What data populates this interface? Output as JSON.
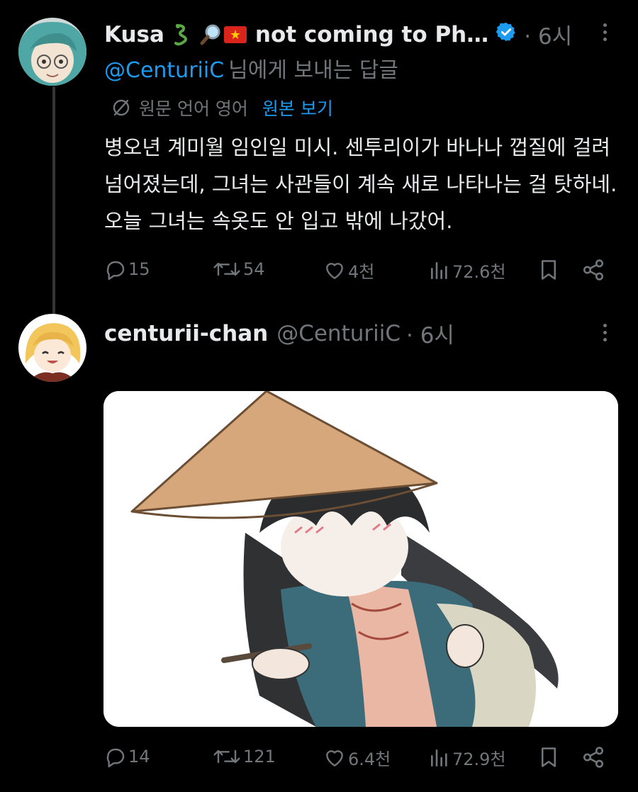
{
  "tweet1": {
    "display_name": "Kusa",
    "name_suffix": "not coming to Ph…",
    "time": "· 6시",
    "reply_handle": "@CenturiiC",
    "reply_suffix": "님에게 보내는 답글",
    "translate_label": "원문 언어 영어",
    "show_original": "원본 보기",
    "text": "병오년 계미월 임인일 미시. 센투리이가 바나나 껍질에 걸려 넘어졌는데, 그녀는 사관들이 계속 새로 나타나는 걸 탓하네. 오늘 그녀는 속옷도 안 입고 밖에 나갔어.",
    "stats": {
      "replies": "15",
      "reposts": "54",
      "likes": "4천",
      "views": "72.6천"
    }
  },
  "tweet2": {
    "display_name": "centurii-chan",
    "handle": "@CenturiiC",
    "time": "· 6시",
    "stats": {
      "replies": "14",
      "reposts": "121",
      "likes": "6.4천",
      "views": "72.9천"
    }
  },
  "colors": {
    "background": "#000000",
    "text": "#e7e9ea",
    "muted": "#71767b",
    "accent": "#1d9bf0"
  }
}
